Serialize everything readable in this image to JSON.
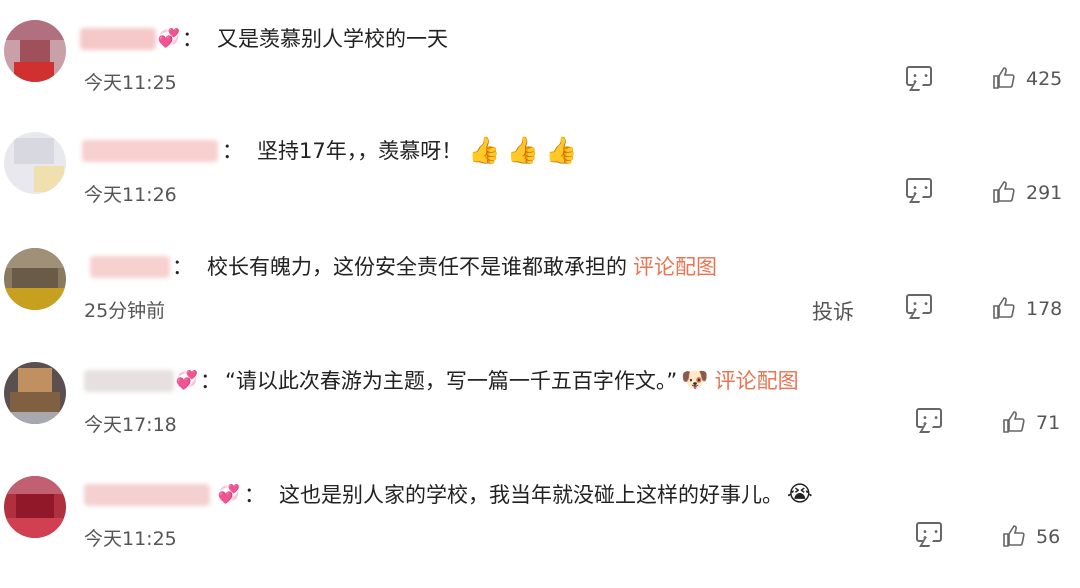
{
  "comments": [
    {
      "text": "又是羡慕别人学校的一天",
      "time": "今天11:25",
      "likes": "425",
      "links": [],
      "emojis": []
    },
    {
      "text": "坚持17年，，羡慕呀！",
      "time": "今天11:26",
      "likes": "291",
      "links": [],
      "emojis": [
        "👍",
        "👍",
        "👍"
      ]
    },
    {
      "text": "校长有魄力，这份安全责任不是谁都敢承担的",
      "time": "25分钟前",
      "likes": "178",
      "links": [
        "评论配图"
      ],
      "emojis": [],
      "report": "投诉"
    },
    {
      "text": "“请以此次春游为主题，写一篇一千五百字作文。”",
      "time": "今天17:18",
      "likes": "71",
      "links": [
        "评论配图"
      ],
      "emojis": [
        "🐶"
      ]
    },
    {
      "text": "这也是别人家的学校，我当年就没碰上这样的好事儿。",
      "time": "今天11:25",
      "likes": "56",
      "links": [],
      "emojis": [
        "😭"
      ]
    }
  ],
  "icons": {
    "reply": "comment-icon",
    "like": "thumbs-up-icon",
    "badge": "fan-badge-icon"
  },
  "colors": {
    "link": "#eb7350",
    "text": "#222222",
    "meta": "#555555"
  }
}
